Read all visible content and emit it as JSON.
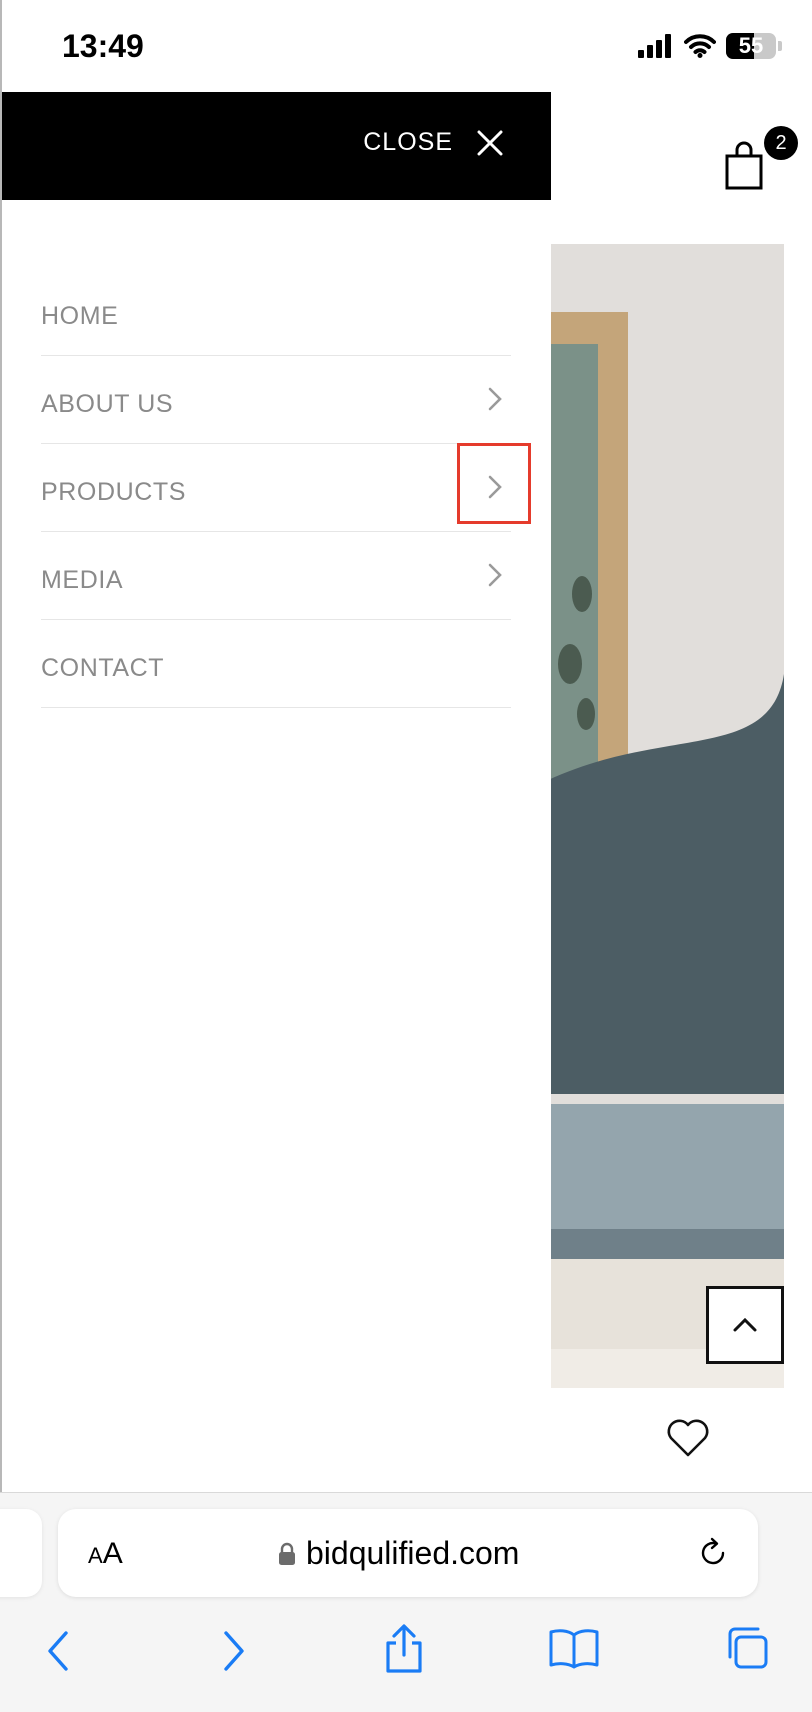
{
  "status_bar": {
    "time": "13:49",
    "battery_level": "55",
    "battery_fraction": 0.55
  },
  "drawer": {
    "close_label": "CLOSE",
    "nav_items": [
      {
        "label": "HOME",
        "has_submenu": false
      },
      {
        "label": "ABOUT US",
        "has_submenu": true
      },
      {
        "label": "PRODUCTS",
        "has_submenu": true
      },
      {
        "label": "MEDIA",
        "has_submenu": true
      },
      {
        "label": "CONTACT",
        "has_submenu": false
      }
    ]
  },
  "header": {
    "cart_count": "2"
  },
  "browser": {
    "text_size_small": "A",
    "text_size_large": "A",
    "url": "bidqulified.com"
  },
  "colors": {
    "accent_blue": "#1a7cf5",
    "highlight_red": "#e53b2c",
    "drawer_header": "#000000",
    "nav_text": "#8a8a8a"
  },
  "icons": {
    "signal": "cellular-signal-icon",
    "wifi": "wifi-icon",
    "close": "close-x-icon",
    "chevron": "chevron-right-icon",
    "cart": "shopping-bag-icon",
    "heart": "heart-icon",
    "scroll_top": "chevron-up-icon",
    "lock": "lock-icon",
    "reload": "reload-icon",
    "back": "back-arrow-icon",
    "forward": "forward-arrow-icon",
    "share": "share-icon",
    "bookmarks": "bookmarks-book-icon",
    "tabs": "tabs-icon"
  }
}
